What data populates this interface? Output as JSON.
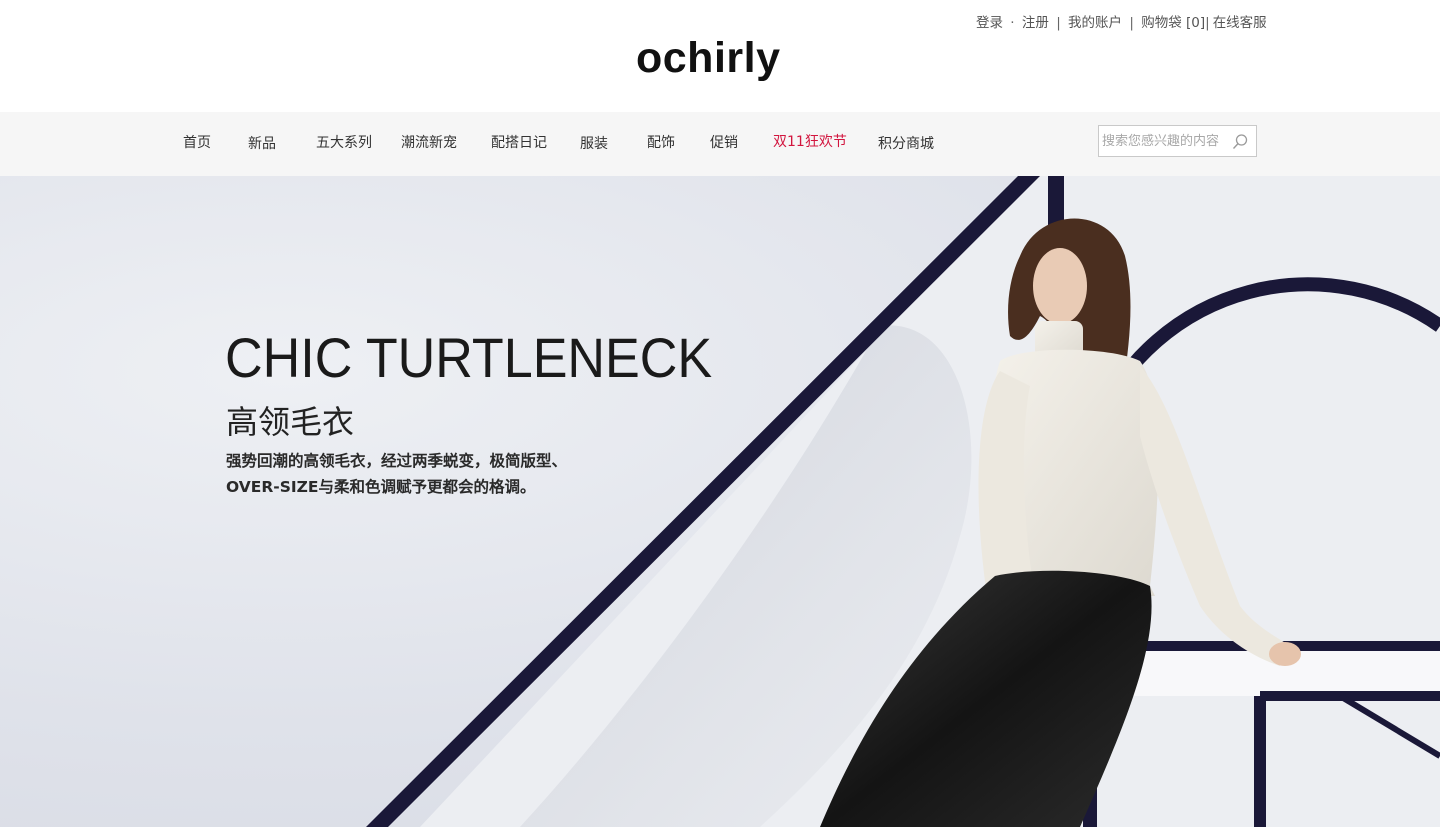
{
  "header": {
    "logo": "ochirly",
    "links": {
      "login": "登录",
      "dot": "·",
      "register": "注册",
      "sep1": "|",
      "account": "我的账户",
      "sep2": "|",
      "bag": "购物袋 [0]",
      "sep3": "|",
      "service": "在线客服"
    }
  },
  "nav": {
    "items": [
      {
        "label": "首页"
      },
      {
        "label": "新品"
      },
      {
        "label": "五大系列"
      },
      {
        "label": "潮流新宠"
      },
      {
        "label": "配搭日记"
      },
      {
        "label": "服装"
      },
      {
        "label": "配饰"
      },
      {
        "label": "促销"
      },
      {
        "label": "双11狂欢节"
      },
      {
        "label": "积分商城"
      }
    ],
    "hot_color": "#d2153e",
    "search": {
      "placeholder": "搜索您感兴趣的内容",
      "icon": "search-icon"
    }
  },
  "banner": {
    "headline": "CHIC TURTLENECK",
    "subheadline": "高领毛衣",
    "desc_line1": "强势回潮的高领毛衣，经过两季蜕变，极简版型、",
    "desc_line2": "OVER-SIZE与柔和色调赋予更都会的格调。",
    "accent_color": "#1a1838"
  }
}
